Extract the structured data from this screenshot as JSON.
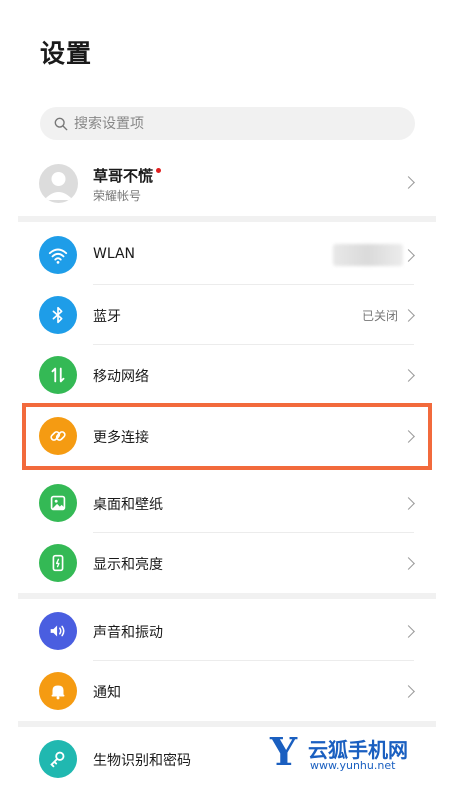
{
  "header": {
    "title": "设置"
  },
  "search": {
    "placeholder": "搜索设置项"
  },
  "account": {
    "name": "草哥不慌",
    "subtitle": "荣耀帐号"
  },
  "items": [
    {
      "label": "WLAN",
      "value": "",
      "icon": "wifi-icon",
      "color": "#1e9de8"
    },
    {
      "label": "蓝牙",
      "value": "已关闭",
      "icon": "bluetooth-icon",
      "color": "#1e9de8"
    },
    {
      "label": "移动网络",
      "value": "",
      "icon": "mobile-network-icon",
      "color": "#34b955"
    },
    {
      "label": "更多连接",
      "value": "",
      "icon": "link-icon",
      "color": "#f59b12"
    },
    {
      "label": "桌面和壁纸",
      "value": "",
      "icon": "wallpaper-icon",
      "color": "#34b955"
    },
    {
      "label": "显示和亮度",
      "value": "",
      "icon": "display-icon",
      "color": "#34b955"
    },
    {
      "label": "声音和振动",
      "value": "",
      "icon": "sound-icon",
      "color": "#4a5ee0"
    },
    {
      "label": "通知",
      "value": "",
      "icon": "bell-icon",
      "color": "#f59b12"
    },
    {
      "label": "生物识别和密码",
      "value": "",
      "icon": "key-icon",
      "color": "#20b8b0"
    }
  ],
  "watermark": {
    "letter": "Y",
    "name": "云狐手机网",
    "url": "www.yunhu.net"
  },
  "highlight_color": "#f26a3c"
}
